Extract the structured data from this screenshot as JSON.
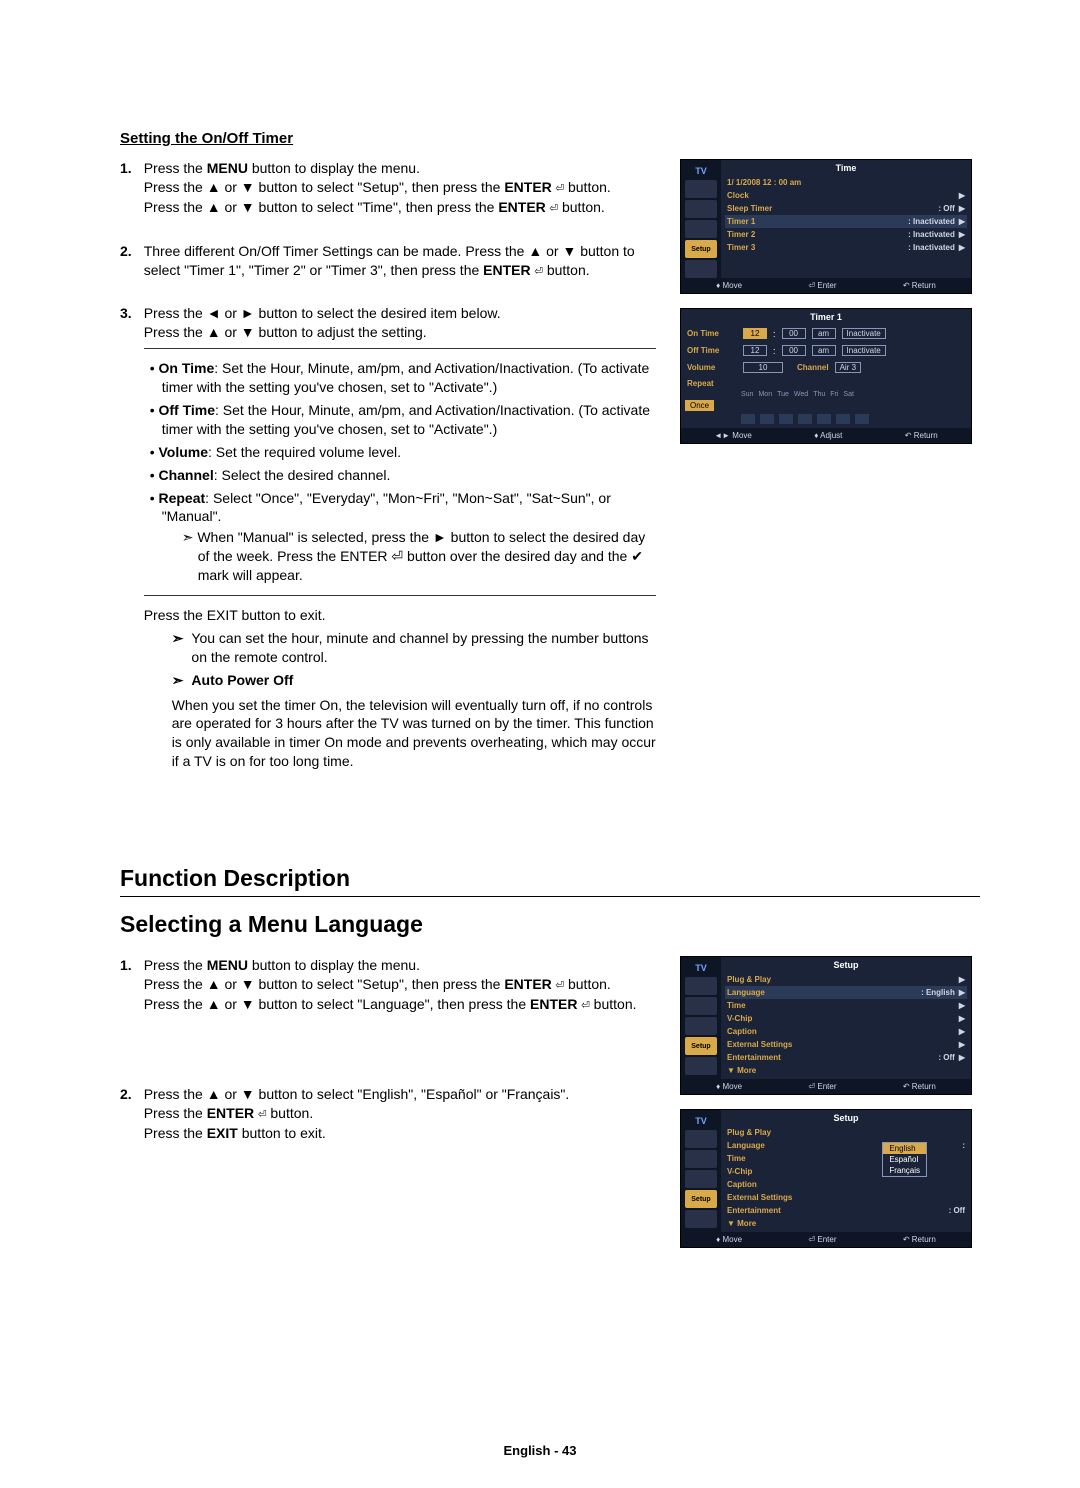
{
  "section1_title": "Setting the On/Off Timer",
  "steps1": {
    "n1": "1.",
    "t1a": "Press the ",
    "t1_menu": "MENU",
    "t1b": " button to display the menu.",
    "t1c": "Press the ▲ or ▼ button to select \"Setup\", then press the ",
    "t1_enter": "ENTER",
    "t1d": " button.",
    "t1e": "Press the ▲ or ▼ button to select \"Time\", then press the ",
    "t1f": " button.",
    "n2": "2.",
    "t2a": "Three different On/Off Timer Settings can be made. Press the ▲ or ▼ button to select \"Timer 1\", \"Timer 2\" or \"Timer 3\", then press the ",
    "t2b": " button.",
    "n3": "3.",
    "t3a": "Press the ◄ or ► button to select the desired item below.",
    "t3b": "Press the ▲ or ▼ button to adjust the setting.",
    "li_on_b": "On Time",
    "li_on_t": ": Set the Hour, Minute, am/pm, and Activation/Inactivation. (To activate timer with the setting you've chosen, set to \"Activate\".)",
    "li_off_b": "Off Time",
    "li_off_t": ": Set the Hour, Minute, am/pm, and Activation/Inactivation. (To activate timer with the setting you've chosen, set to \"Activate\".)",
    "li_vol_b": "Volume",
    "li_vol_t": ": Set the required volume level.",
    "li_ch_b": "Channel",
    "li_ch_t": ": Select the desired channel.",
    "li_rep_b": "Repeat",
    "li_rep_t": ": Select \"Once\", \"Everyday\", \"Mon~Fri\", \"Mon~Sat\", \"Sat~Sun\", or \"Manual\".",
    "li_rep_sub": "When \"Manual\" is selected, press the ► button to select the desired day of the week. Press the ENTER ⏎ button over the desired day and the ✔ mark will appear.",
    "exit_line": "Press the EXIT button to exit.",
    "note1": "You can set the hour, minute and channel by pressing the number buttons on the remote control.",
    "auto_b": "Auto Power Off",
    "auto_t": "When you set the timer On, the television will eventually turn off, if no controls are operated for 3 hours after the TV was turned on by the timer. This function is only available in timer On mode and prevents overheating, which may occur if a TV is on for too long time."
  },
  "heading_func": "Function Description",
  "heading_lang": "Selecting a Menu Language",
  "steps2": {
    "n1": "1.",
    "t1a": "Press the ",
    "t1_menu": "MENU",
    "t1b": " button to display the menu.",
    "t1c": "Press the ▲ or ▼ button to select \"Setup\", then press the ",
    "t1_enter": "ENTER",
    "t1d": " button.",
    "t1e": "Press the ▲ or ▼ button to select \"Language\", then press the ",
    "t1f": " button.",
    "n2": "2.",
    "t2a": "Press the ▲ or ▼ button to select \"English\", \"Español\" or \"Français\".",
    "t2b": "Press the ",
    "t2c": " button.",
    "t2d": "Press the ",
    "t2_exit": "EXIT",
    "t2e": " button to exit."
  },
  "osd_time": {
    "tv": "TV",
    "title": "Time",
    "datetime": "1/  1/2008  12 : 00 am",
    "clock": "Clock",
    "sleep": "Sleep Timer",
    "off": ": Off",
    "t1": "Timer 1",
    "t2": "Timer 2",
    "t3": "Timer 3",
    "inact": ": Inactivated",
    "setup": "Setup",
    "move": "Move",
    "enter": "Enter",
    "ret": "Return"
  },
  "osd_timer": {
    "title": "Timer 1",
    "on": "On Time",
    "off": "Off Time",
    "vol": "Volume",
    "ch": "Channel",
    "rep": "Repeat",
    "h": "12",
    "m": "00",
    "ampm": "am",
    "inact": "Inactivate",
    "v10": "10",
    "air": "Air  3",
    "once": "Once",
    "days": [
      "Sun",
      "Mon",
      "Tue",
      "Wed",
      "Thu",
      "Fri",
      "Sat"
    ],
    "move": "Move",
    "adj": "Adjust",
    "ret": "Return"
  },
  "osd_setup": {
    "tv": "TV",
    "title": "Setup",
    "pnp": "Plug & Play",
    "lang": "Language",
    "lval": ": English",
    "time": "Time",
    "vchip": "V-Chip",
    "cap": "Caption",
    "ext": "External Settings",
    "ent": "Entertainment",
    "off": ": Off",
    "more": "▼ More",
    "setup": "Setup",
    "move": "Move",
    "enter": "Enter",
    "ret": "Return"
  },
  "osd_lang": {
    "en": "English",
    "es": "Español",
    "fr": "Français"
  },
  "footer": "English - 43",
  "glyph": {
    "enter": "⏎",
    "tri": "▶",
    "updown": "♦",
    "lr": "◄►",
    "ret_sym": "↶",
    "arr": "➣"
  }
}
